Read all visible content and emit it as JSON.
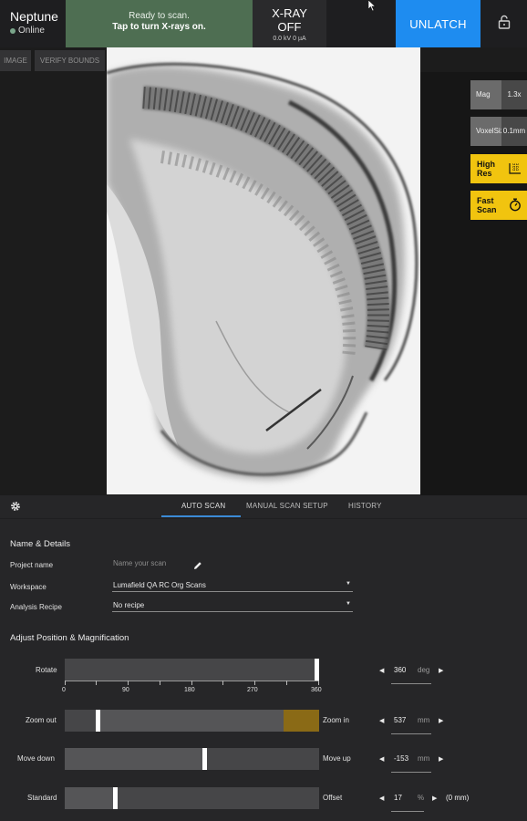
{
  "header": {
    "device_name": "Neptune",
    "device_status": "Online",
    "scan_status_line1": "Ready to scan.",
    "scan_status_line2": "Tap to turn X-rays on.",
    "xray_label_line1": "X-RAY",
    "xray_label_line2": "OFF",
    "xray_readout": "0.0 kV 0 µA",
    "unlatch_label": "UNLATCH",
    "colors": {
      "status_bg": "#4e6e52",
      "unlatch_bg": "#1e8cf0",
      "online_dot": "#7aa58a"
    }
  },
  "viewer": {
    "buttons": [
      {
        "label": "IMAGE"
      },
      {
        "label": "VERIFY BOUNDS"
      }
    ],
    "mag": {
      "label": "Mag",
      "value": "1.3x"
    },
    "voxel": {
      "label_line1": "Voxel",
      "label_line2": "Size",
      "value_line1": "0.1",
      "value_line2": "mm"
    },
    "modes": [
      {
        "label_line1": "High",
        "label_line2": "Res",
        "icon": "grid-ruler-icon"
      },
      {
        "label_line1": "Fast",
        "label_line2": "Scan",
        "icon": "stopwatch-icon"
      }
    ],
    "accent_color": "#f1c40f"
  },
  "panel": {
    "tabs": [
      {
        "label": "AUTO SCAN",
        "active": true
      },
      {
        "label": "MANUAL SCAN SETUP",
        "active": false
      },
      {
        "label": "HISTORY",
        "active": false
      }
    ],
    "name_details": {
      "heading": "Name & Details",
      "project_name_label": "Project name",
      "project_name_placeholder": "Name your scan",
      "workspace_label": "Workspace",
      "workspace_value": "Lumafield QA RC Org Scans",
      "recipe_label": "Analysis Recipe",
      "recipe_value": "No recipe"
    },
    "position": {
      "heading": "Adjust Position & Magnification",
      "rotate": {
        "label": "Rotate",
        "value": "360",
        "unit": "deg",
        "fraction": 1.0,
        "ticks": [
          "0",
          "90",
          "180",
          "270",
          "360"
        ]
      },
      "zoom": {
        "left_label": "Zoom out",
        "right_label": "Zoom in",
        "value": "537",
        "unit": "mm",
        "handle_fraction": 0.13,
        "range_end_fraction": 0.86,
        "highlight_color": "#8a6a16"
      },
      "move": {
        "left_label": "Move down",
        "right_label": "Move up",
        "value": "-153",
        "unit": "mm",
        "handle_fraction": 0.55
      },
      "offset": {
        "left_label": "Standard",
        "right_label": "Offset",
        "value": "17",
        "unit": "%",
        "extra": "(0 mm)",
        "handle_fraction": 0.2
      }
    }
  }
}
